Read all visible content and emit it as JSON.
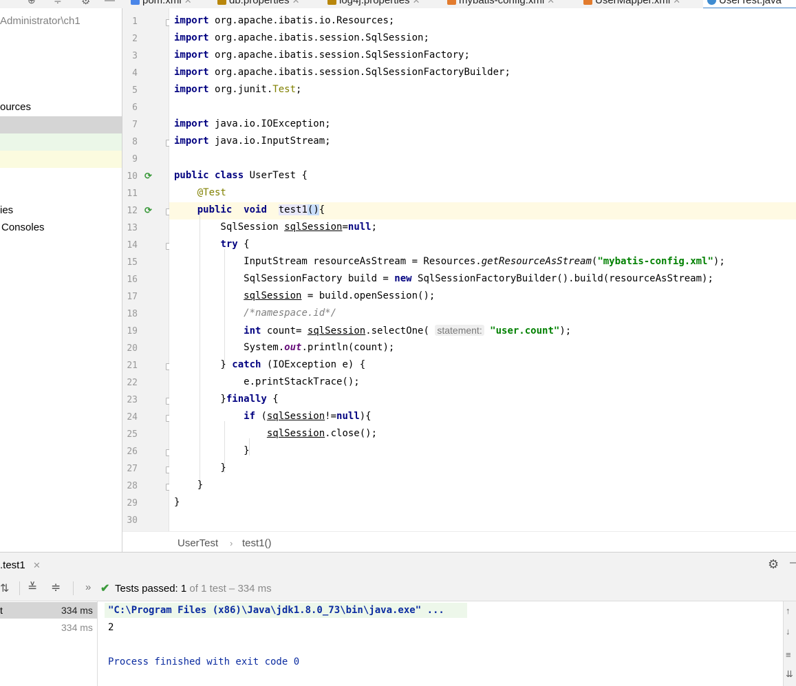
{
  "tabs": [
    {
      "label": "pom.xml",
      "icon": "maven-icon",
      "color": "#4a86e8"
    },
    {
      "label": "db.properties",
      "icon": "properties-file-icon",
      "color": "#b8860b"
    },
    {
      "label": "log4j.properties",
      "icon": "properties-file-icon",
      "color": "#b8860b"
    },
    {
      "label": "mybatis-config.xml",
      "icon": "xml-file-icon",
      "color": "#e27b2d"
    },
    {
      "label": "UserMapper.xml",
      "icon": "xml-file-icon",
      "color": "#e27b2d"
    },
    {
      "label": "UserTest.java",
      "icon": "java-class-icon",
      "color": "#3d8bd1",
      "active": true
    }
  ],
  "project": {
    "path": "Administrator\\ch1",
    "resources": "ources",
    "libraries": "ies",
    "consoles": "Consoles"
  },
  "editor": {
    "line_numbers": [
      "1",
      "2",
      "3",
      "4",
      "5",
      "6",
      "7",
      "8",
      "9",
      "10",
      "11",
      "12",
      "13",
      "14",
      "15",
      "16",
      "17",
      "18",
      "19",
      "20",
      "21",
      "22",
      "23",
      "24",
      "25",
      "26",
      "27",
      "28",
      "29",
      "30"
    ],
    "inlay_hint": "statement:"
  },
  "breadcrumb": {
    "class_name": "UserTest",
    "method_name": "test1()"
  },
  "run": {
    "tab_label": ".test1",
    "status_prefix": "Tests passed: ",
    "passed": "1",
    "status_suffix": " of 1 test – 334 ms",
    "tree_rows": [
      {
        "label": "t",
        "time": "334 ms"
      },
      {
        "label": "",
        "time": "334 ms"
      }
    ],
    "console_lines": [
      "\"C:\\Program Files (x86)\\Java\\jdk1.8.0_73\\bin\\java.exe\" ...",
      "2",
      "",
      "Process finished with exit code 0"
    ]
  },
  "colors": {
    "keyword": "#000080",
    "annotation": "#808000",
    "string": "#008000",
    "comment": "#808080",
    "static_field": "#660e7a",
    "console_blue": "#0b2ca0",
    "accent": "#4083c9",
    "caret_row": "#fffae3"
  }
}
